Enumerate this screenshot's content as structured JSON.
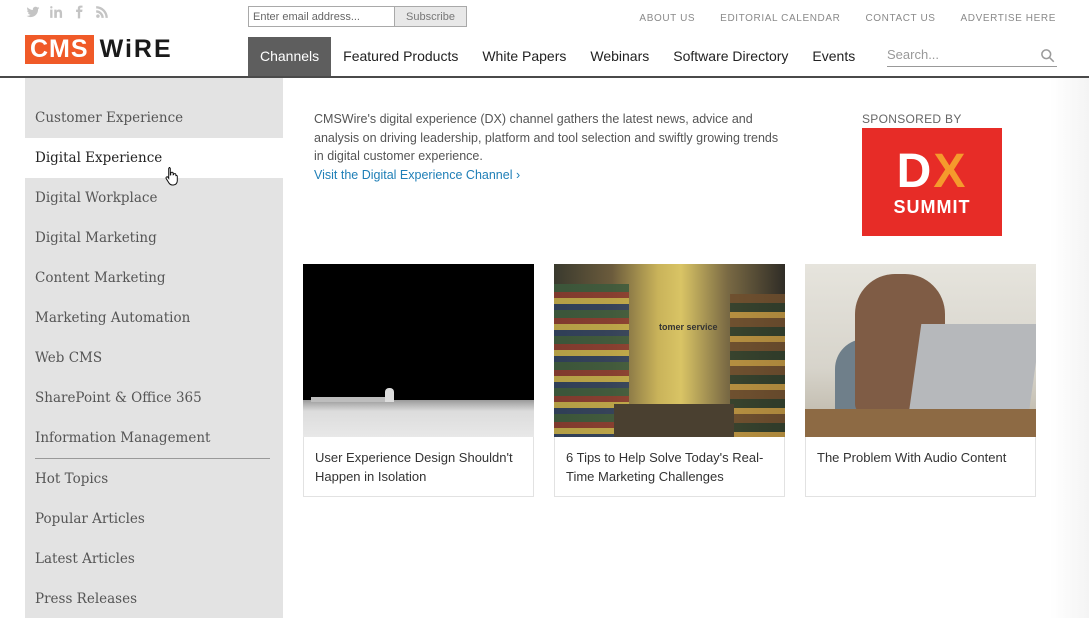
{
  "social": {
    "icons": [
      "twitter-icon",
      "linkedin-icon",
      "facebook-icon",
      "rss-icon"
    ]
  },
  "subscribe": {
    "placeholder": "Enter email address...",
    "button": "Subscribe"
  },
  "top_links": [
    "ABOUT US",
    "EDITORIAL CALENDAR",
    "CONTACT US",
    "ADVERTISE HERE"
  ],
  "logo": {
    "part1": "CMS",
    "part2": "WiRE"
  },
  "nav": {
    "items": [
      "Channels",
      "Featured Products",
      "White Papers",
      "Webinars",
      "Software Directory",
      "Events"
    ],
    "active": "Channels",
    "search_placeholder": "Search..."
  },
  "sidebar": {
    "items": [
      "Customer Experience",
      "Digital Experience",
      "Digital Workplace",
      "Digital Marketing",
      "Content Marketing",
      "Marketing Automation",
      "Web CMS",
      "SharePoint & Office 365",
      "Information Management"
    ],
    "active": "Digital Experience",
    "secondary": [
      "Hot Topics",
      "Popular Articles",
      "Latest Articles",
      "Press Releases"
    ]
  },
  "intro": {
    "text": "CMSWire's digital experience (DX) channel gathers the latest news, advice and analysis on driving leadership, platform and tool selection and swiftly growing trends in digital customer experience.",
    "link": "Visit the Digital Experience Channel ›"
  },
  "sponsor": {
    "label": "SPONSORED BY",
    "logo_main_left": "D",
    "logo_main_right": "X",
    "logo_sub": "SUMMIT"
  },
  "articles": [
    {
      "title": "User Experience Design Shouldn't Happen in Isolation"
    },
    {
      "title": "6 Tips to Help Solve Today's Real-Time Marketing Challenges",
      "image_text": "tomer service"
    },
    {
      "title": "The Problem With Audio Content"
    }
  ],
  "colors": {
    "brand_orange": "#f05a28",
    "nav_active": "#5e5e5e",
    "link_blue": "#1f7fb7",
    "sponsor_red": "#e72c27",
    "sidebar_bg": "#e3e3e3"
  }
}
